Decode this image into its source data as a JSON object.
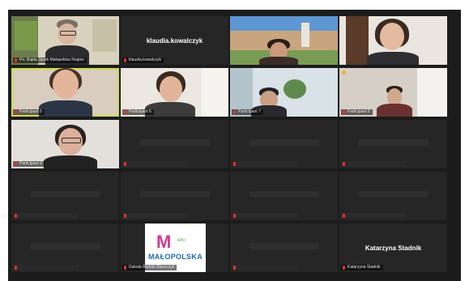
{
  "meeting": {
    "participants": [
      {
        "name": "Pn. Bajda Jacek Małopolska Region"
      },
      {
        "name": "klaudia.kowalczyk",
        "tile_label": "klaudia.kowalczyk"
      },
      {
        "name": "Participant 3"
      },
      {
        "name": "Participant 4"
      },
      {
        "name": "Participant 5"
      },
      {
        "name": "Participant 6"
      },
      {
        "name": "Participant 7"
      },
      {
        "name": "Participant 8"
      },
      {
        "name": "Participant 9"
      },
      {
        "name": "Dakota Bartnik Błaszczyk",
        "logo_text": "MAŁOPOLSKA",
        "logo_eko": "eko"
      },
      {
        "name": "Katarzyna Stadnik",
        "tile_label": "Katarzyna Stadnik"
      }
    ]
  },
  "colors": {
    "active_speaker": "#c8e04a",
    "muted": "#e0332e",
    "tile_bg": "#262626"
  }
}
